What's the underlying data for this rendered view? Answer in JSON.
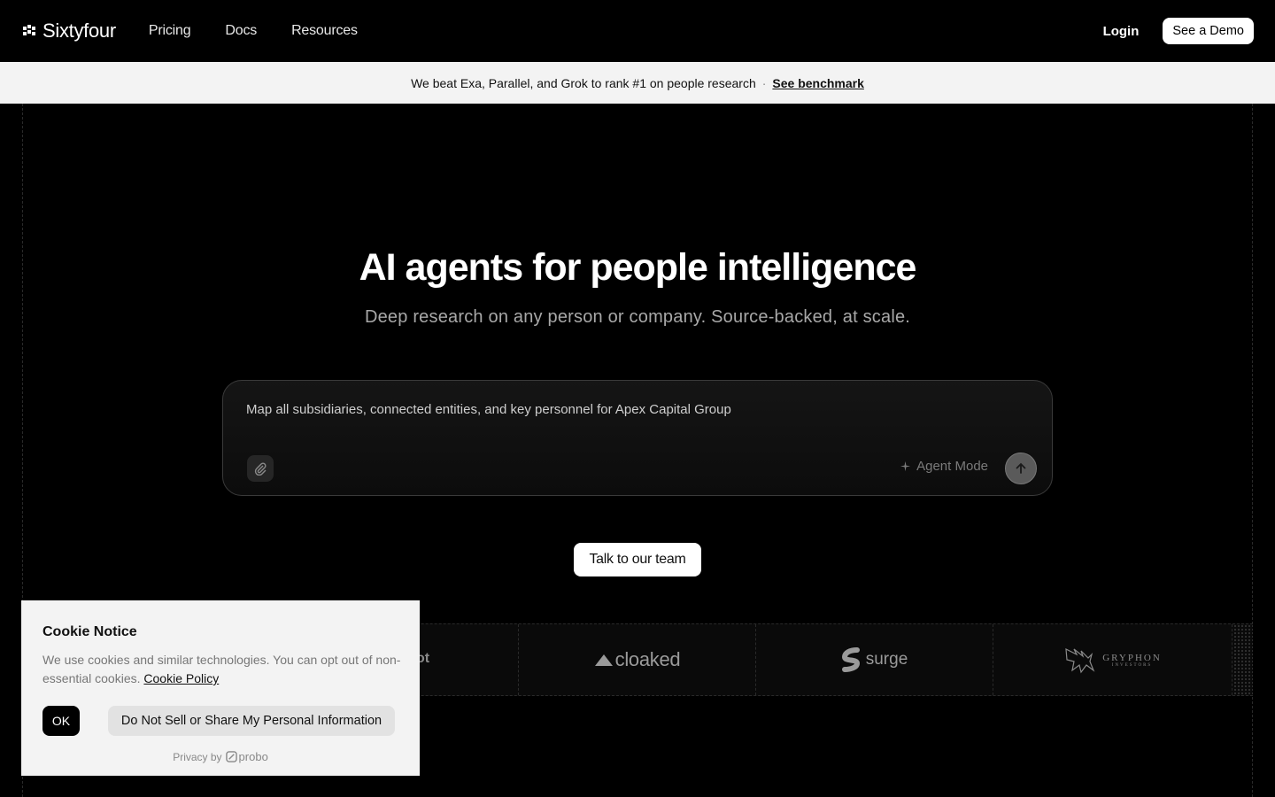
{
  "header": {
    "brand": "Sixtyfour",
    "nav": [
      "Pricing",
      "Docs",
      "Resources"
    ],
    "login": "Login",
    "demo": "See a Demo"
  },
  "banner": {
    "text": "We beat Exa, Parallel, and Grok to rank #1 on people research",
    "separator": "·",
    "link": "See benchmark"
  },
  "hero": {
    "title": "AI agents for people intelligence",
    "subtitle": "Deep research on any person or company. Source-backed, at scale."
  },
  "prompt": {
    "text": "Map all subsidiaries, connected entities, and key personnel for Apex Capital Group",
    "agent_mode": "Agent Mode"
  },
  "cta": {
    "talk": "Talk to our team"
  },
  "logos": {
    "partial": "ot",
    "cloaked": "cloaked",
    "surge": "surge",
    "gryphon": "GRYPHON",
    "gryphon_sub": "INVESTORS"
  },
  "cookie": {
    "title": "Cookie Notice",
    "body": "We use cookies and similar technologies. You can opt out of non-essential cookies.",
    "policy_link": "Cookie Policy",
    "ok": "OK",
    "dns": "Do Not Sell or Share My Personal Information",
    "privacy_by": "Privacy by",
    "provider": "probo"
  }
}
